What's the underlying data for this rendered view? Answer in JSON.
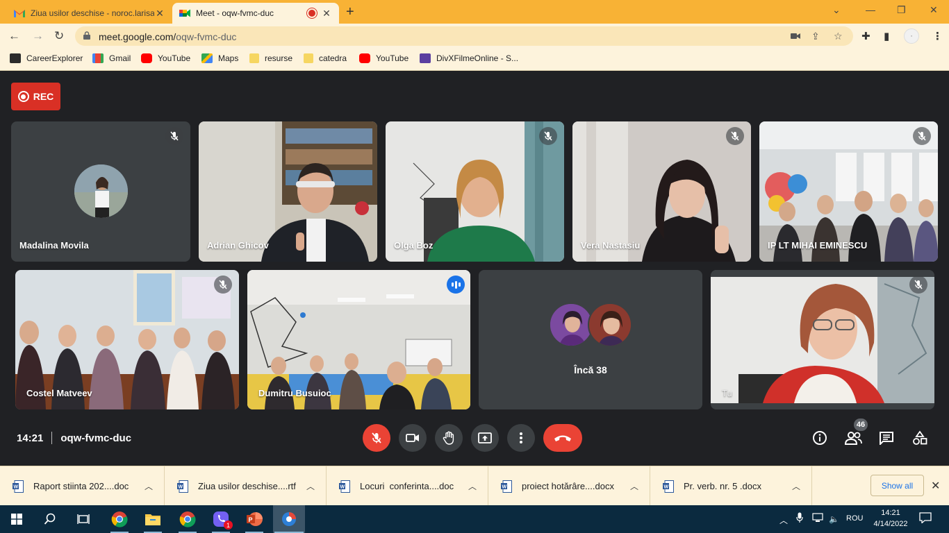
{
  "browser": {
    "tabs": [
      {
        "title": "Ziua usilor deschise - noroc.larisa",
        "favicon": "gmail-icon",
        "active": false
      },
      {
        "title": "Meet - oqw-fvmc-duc",
        "favicon": "meet-icon",
        "active": true
      }
    ],
    "url_host": "meet.google.com/",
    "url_path": "oqw-fvmc-duc",
    "bookmarks": [
      {
        "label": "CareerExplorer",
        "icon": "careerexplorer-icon"
      },
      {
        "label": "Gmail",
        "icon": "gmail-icon"
      },
      {
        "label": "YouTube",
        "icon": "youtube-icon"
      },
      {
        "label": "Maps",
        "icon": "maps-icon"
      },
      {
        "label": "resurse",
        "icon": "folder-icon"
      },
      {
        "label": "catedra",
        "icon": "folder-icon"
      },
      {
        "label": "YouTube",
        "icon": "youtube-icon"
      },
      {
        "label": "DivXFilmeOnline - S...",
        "icon": "divx-icon"
      }
    ]
  },
  "meet": {
    "rec_label": "REC",
    "participants": [
      {
        "name": "Madalina Movila",
        "mic": "off"
      },
      {
        "name": "Adrian Ghicov",
        "mic": "on"
      },
      {
        "name": "Olga Boz",
        "mic": "off"
      },
      {
        "name": "Vera Nastasiu",
        "mic": "off"
      },
      {
        "name": "IP LT MIHAI EMINESCU",
        "mic": "off"
      },
      {
        "name": "Costel Matveev",
        "mic": "off"
      },
      {
        "name": "Dumitru Busuioc",
        "mic": "speaking"
      },
      {
        "name": "Tu",
        "mic": "off"
      }
    ],
    "more_label": "Încă 38",
    "time": "14:21",
    "meeting_code": "oqw-fvmc-duc",
    "participant_count": "46",
    "colors": {
      "accent_red": "#ea4335",
      "speaking_blue": "#1a73e8",
      "background": "#202124"
    }
  },
  "downloads": {
    "items": [
      {
        "name": "Raport stiinta 202....doc"
      },
      {
        "name": "Ziua usilor deschise....rtf"
      },
      {
        "name": "Locuri  conferinta....doc"
      },
      {
        "name": "proiect hotărâre....docx"
      },
      {
        "name": "Pr. verb. nr. 5 .docx"
      }
    ],
    "show_all": "Show all"
  },
  "taskbar": {
    "language": "ROU",
    "time": "14:21",
    "date": "4/14/2022",
    "viber_badge": "1"
  }
}
